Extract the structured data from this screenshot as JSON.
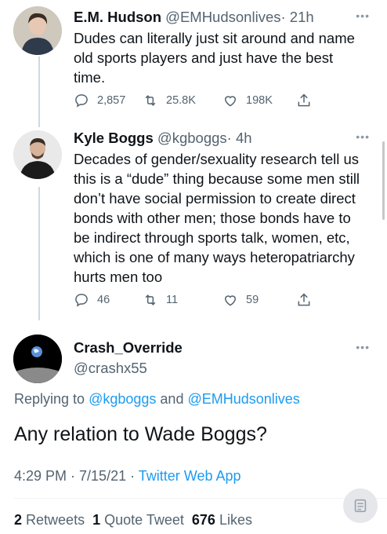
{
  "tweets": [
    {
      "name": "E.M. Hudson",
      "handle": "@EMHudsonlives",
      "time": "· 21h",
      "text": "Dudes can literally just sit around and name old sports players and just have the best time.",
      "replies": "2,857",
      "retweets": "25.8K",
      "likes": "198K"
    },
    {
      "name": "Kyle Boggs",
      "handle": "@kgboggs",
      "time": "· 4h",
      "text": "Decades of gender/sexuality research tell us this is a “dude” thing because some men still don’t have social permission to create direct bonds with other men; those bonds have to be indirect through sports talk, women, etc, which is one of many ways heteropatriarchy hurts men too",
      "replies": "46",
      "retweets": "11",
      "likes": "59"
    }
  ],
  "main_tweet": {
    "name": "Crash_Override",
    "handle": "@crashx55",
    "replying_prefix": "Replying to",
    "replying_user1": "@kgboggs",
    "replying_and": "and",
    "replying_user2": "@EMHudsonlives",
    "text": "Any relation to Wade Boggs?",
    "timestamp": "4:29 PM · 7/15/21 ·",
    "source": "Twitter Web App",
    "retweets_count": "2",
    "retweets_label": "Retweets",
    "quote_count": "1",
    "quote_label": "Quote Tweet",
    "likes_count": "676",
    "likes_label": "Likes"
  },
  "more_icon": "more-dots-icon",
  "colors": {
    "link": "#1d9bf0",
    "secondary": "#536471",
    "text": "#0f1419"
  }
}
